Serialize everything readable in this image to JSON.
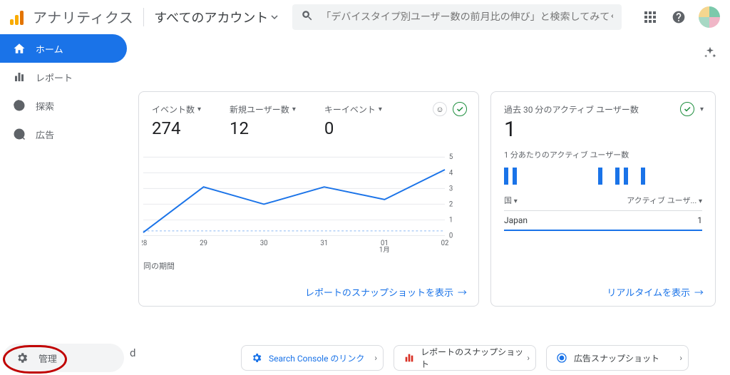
{
  "header": {
    "product": "アナリティクス",
    "account": "すべてのアカウント",
    "search_placeholder": "「デバイスタイプ別ユーザー数の前月比の伸び」と検索してみてくだ..."
  },
  "sidebar": {
    "items": [
      {
        "label": "ホーム"
      },
      {
        "label": "レポート"
      },
      {
        "label": "探索"
      },
      {
        "label": "広告"
      }
    ],
    "admin": "管理"
  },
  "main": {
    "metrics": [
      {
        "label": "イベント数",
        "value": "274"
      },
      {
        "label": "新規ユーザー数",
        "value": "12"
      },
      {
        "label": "キーイベント",
        "value": "0"
      }
    ],
    "compare_label": "同の期間",
    "snapshot_action": "レポートのスナップショットを表示",
    "chart_data": {
      "type": "line",
      "x": [
        "28",
        "29",
        "30",
        "31",
        "01\n1月",
        "02"
      ],
      "values": [
        0.2,
        3.1,
        2.0,
        3.1,
        2.3,
        4.2
      ],
      "ylim": [
        0,
        5
      ],
      "ylabel": "",
      "xlabel": "",
      "compare_line": 0.3
    }
  },
  "realtime": {
    "title": "過去 30 分のアクティブ ユーザー数",
    "big_value": "1",
    "subtitle": "1 分あたりのアクティブ ユーザー数",
    "bars": [
      1,
      1,
      0,
      0,
      0,
      0,
      0,
      0,
      0,
      0,
      0,
      1,
      0,
      1,
      1,
      0,
      1
    ],
    "col_country": "国",
    "col_users": "アクティブ ユーザ...",
    "rows": [
      {
        "country": "Japan",
        "users": "1"
      }
    ],
    "action": "リアルタイムを表示"
  },
  "section": {
    "title": "d"
  },
  "link_cards": [
    {
      "icon": "gear-blue",
      "label": "Search Console のリンク"
    },
    {
      "icon": "report-red",
      "label": "レポートのスナップショット"
    },
    {
      "icon": "ads-blue",
      "label": "広告スナップショット"
    }
  ]
}
